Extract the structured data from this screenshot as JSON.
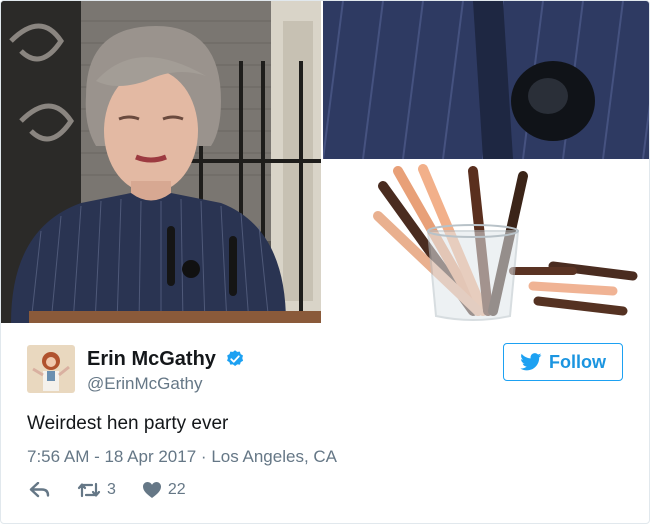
{
  "tweet": {
    "display_name": "Erin McGathy",
    "handle": "@ErinMcGathy",
    "follow_label": "Follow",
    "text": "Weirdest hen party ever",
    "timestamp": "7:56 AM - 18 Apr 2017",
    "separator": "·",
    "location": "Los Angeles, CA",
    "retweets": "3",
    "likes": "22"
  },
  "colors": {
    "accent": "#1da1f2",
    "text": "#14171a",
    "muted": "#657786"
  },
  "icons": [
    "verified-badge-icon",
    "bird-icon",
    "reply-icon",
    "retweet-icon",
    "heart-icon"
  ]
}
